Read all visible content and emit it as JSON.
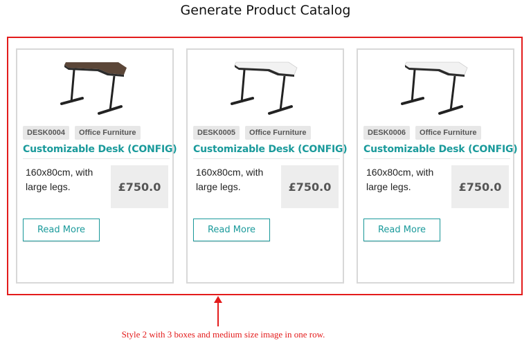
{
  "page": {
    "title": "Generate Product Catalog",
    "caption": "Style 2 with 3 boxes and medium size image in one row."
  },
  "colors": {
    "accent": "#1a9a9b",
    "highlight_border": "#e31b1b",
    "tag_bg": "#e7e7e7",
    "price_bg": "#ededed"
  },
  "products": [
    {
      "code": "DESK0004",
      "category": "Office Furniture",
      "name": "Customizable Desk (CONFIG)",
      "description": "160x80cm, with large legs.",
      "price": "£750.0",
      "button_label": "Read More",
      "image": "l-shaped-desk-walnut"
    },
    {
      "code": "DESK0005",
      "category": "Office Furniture",
      "name": "Customizable Desk (CONFIG)",
      "description": "160x80cm, with large legs.",
      "price": "£750.0",
      "button_label": "Read More",
      "image": "l-shaped-desk-white"
    },
    {
      "code": "DESK0006",
      "category": "Office Furniture",
      "name": "Customizable Desk (CONFIG)",
      "description": "160x80cm, with large legs.",
      "price": "£750.0",
      "button_label": "Read More",
      "image": "l-shaped-desk-white"
    }
  ]
}
